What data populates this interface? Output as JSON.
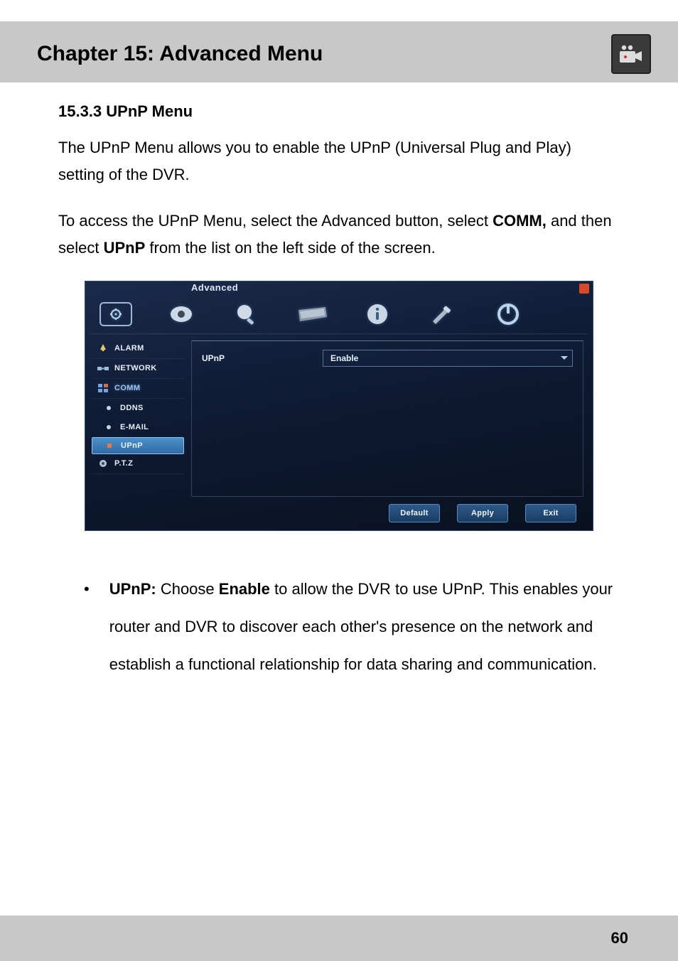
{
  "header": {
    "title": "Chapter 15: Advanced Menu",
    "icon": "camera-icon"
  },
  "section": {
    "number_title": "15.3.3 UPnP Menu",
    "intro": "The UPnP Menu allows you to enable the UPnP (Universal Plug and Play) setting of the DVR.",
    "access_pre": "To access the UPnP Menu, select the Advanced button, select ",
    "access_bold1": "COMM,",
    "access_mid": " and then select ",
    "access_bold2": "UPnP",
    "access_post": " from the list on the left side of the screen."
  },
  "screenshot": {
    "window_title": "Advanced",
    "sidebar": {
      "items": [
        {
          "label": "ALARM",
          "icon": "bell-icon"
        },
        {
          "label": "NETWORK",
          "icon": "network-icon"
        },
        {
          "label": "COMM",
          "icon": "grid-icon"
        },
        {
          "label": "DDNS",
          "icon": "dot-icon"
        },
        {
          "label": "E-MAIL",
          "icon": "dot-icon"
        },
        {
          "label": "UPnP",
          "icon": "dot-icon"
        },
        {
          "label": "P.T.Z",
          "icon": "ptz-icon"
        }
      ]
    },
    "field": {
      "label": "UPnP",
      "value": "Enable"
    },
    "buttons": {
      "default": "Default",
      "apply": "Apply",
      "exit": "Exit"
    }
  },
  "bullet": {
    "label_bold": "UPnP:",
    "text_pre": " Choose ",
    "text_bold": "Enable",
    "text_post": " to allow the DVR to use UPnP. This enables your router and DVR to discover each other's presence on the network and establish a functional relationship for data sharing and communication."
  },
  "footer": {
    "page_number": "60"
  }
}
